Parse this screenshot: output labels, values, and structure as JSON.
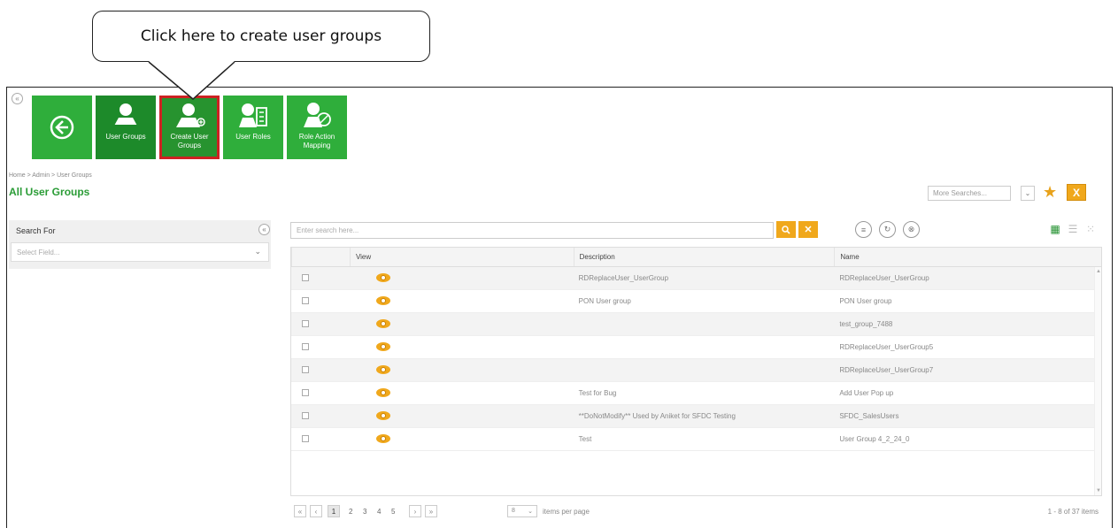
{
  "callout": {
    "text": "Click here to create user groups"
  },
  "toolbar": {
    "tiles": [
      {
        "label": ""
      },
      {
        "label": "User Groups"
      },
      {
        "label": "Create User Groups"
      },
      {
        "label": "User Roles"
      },
      {
        "label": "Role Action Mapping"
      }
    ]
  },
  "breadcrumb": "Home  >  Admin  >  User Groups",
  "page_title": "All User Groups",
  "more_searches": {
    "placeholder": "More Searches..."
  },
  "left_panel": {
    "title": "Search For",
    "select_placeholder": "Select Field..."
  },
  "grid": {
    "search_placeholder": "Enter search here...",
    "columns": [
      "",
      "View",
      "Description",
      "Name"
    ],
    "rows": [
      {
        "description": "RDReplaceUser_UserGroup",
        "name": "RDReplaceUser_UserGroup"
      },
      {
        "description": "PON User group",
        "name": "PON User group"
      },
      {
        "description": "",
        "name": "test_group_7488"
      },
      {
        "description": "",
        "name": "RDReplaceUser_UserGroup5"
      },
      {
        "description": "",
        "name": "RDReplaceUser_UserGroup7"
      },
      {
        "description": "Test for Bug",
        "name": "Add User Pop up"
      },
      {
        "description": "**DoNotModify** Used by Aniket for SFDC Testing",
        "name": "SFDC_SalesUsers"
      },
      {
        "description": "Test",
        "name": "User Group 4_2_24_0"
      }
    ]
  },
  "pager": {
    "first": "«",
    "prev": "‹",
    "pages": [
      "1",
      "2",
      "3",
      "4",
      "5"
    ],
    "next": "›",
    "last": "»",
    "per_page": "8",
    "per_page_label": "items per page",
    "info": "1 - 8 of 37 items"
  },
  "colors": {
    "tile_green": "#2fae3b",
    "accent_orange": "#f0a81c",
    "title_green": "#2a9c36",
    "highlight_red": "#cc2222"
  }
}
